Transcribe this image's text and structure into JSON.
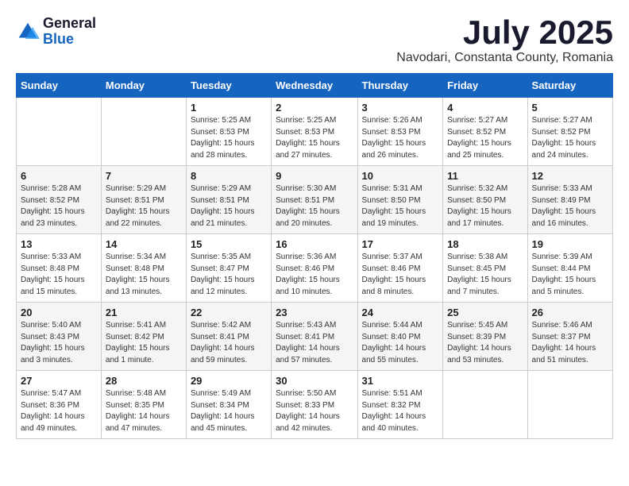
{
  "logo": {
    "general": "General",
    "blue": "Blue"
  },
  "title": {
    "month": "July 2025",
    "location": "Navodari, Constanta County, Romania"
  },
  "weekdays": [
    "Sunday",
    "Monday",
    "Tuesday",
    "Wednesday",
    "Thursday",
    "Friday",
    "Saturday"
  ],
  "weeks": [
    [
      {
        "day": "",
        "info": ""
      },
      {
        "day": "",
        "info": ""
      },
      {
        "day": "1",
        "info": "Sunrise: 5:25 AM\nSunset: 8:53 PM\nDaylight: 15 hours\nand 28 minutes."
      },
      {
        "day": "2",
        "info": "Sunrise: 5:25 AM\nSunset: 8:53 PM\nDaylight: 15 hours\nand 27 minutes."
      },
      {
        "day": "3",
        "info": "Sunrise: 5:26 AM\nSunset: 8:53 PM\nDaylight: 15 hours\nand 26 minutes."
      },
      {
        "day": "4",
        "info": "Sunrise: 5:27 AM\nSunset: 8:52 PM\nDaylight: 15 hours\nand 25 minutes."
      },
      {
        "day": "5",
        "info": "Sunrise: 5:27 AM\nSunset: 8:52 PM\nDaylight: 15 hours\nand 24 minutes."
      }
    ],
    [
      {
        "day": "6",
        "info": "Sunrise: 5:28 AM\nSunset: 8:52 PM\nDaylight: 15 hours\nand 23 minutes."
      },
      {
        "day": "7",
        "info": "Sunrise: 5:29 AM\nSunset: 8:51 PM\nDaylight: 15 hours\nand 22 minutes."
      },
      {
        "day": "8",
        "info": "Sunrise: 5:29 AM\nSunset: 8:51 PM\nDaylight: 15 hours\nand 21 minutes."
      },
      {
        "day": "9",
        "info": "Sunrise: 5:30 AM\nSunset: 8:51 PM\nDaylight: 15 hours\nand 20 minutes."
      },
      {
        "day": "10",
        "info": "Sunrise: 5:31 AM\nSunset: 8:50 PM\nDaylight: 15 hours\nand 19 minutes."
      },
      {
        "day": "11",
        "info": "Sunrise: 5:32 AM\nSunset: 8:50 PM\nDaylight: 15 hours\nand 17 minutes."
      },
      {
        "day": "12",
        "info": "Sunrise: 5:33 AM\nSunset: 8:49 PM\nDaylight: 15 hours\nand 16 minutes."
      }
    ],
    [
      {
        "day": "13",
        "info": "Sunrise: 5:33 AM\nSunset: 8:48 PM\nDaylight: 15 hours\nand 15 minutes."
      },
      {
        "day": "14",
        "info": "Sunrise: 5:34 AM\nSunset: 8:48 PM\nDaylight: 15 hours\nand 13 minutes."
      },
      {
        "day": "15",
        "info": "Sunrise: 5:35 AM\nSunset: 8:47 PM\nDaylight: 15 hours\nand 12 minutes."
      },
      {
        "day": "16",
        "info": "Sunrise: 5:36 AM\nSunset: 8:46 PM\nDaylight: 15 hours\nand 10 minutes."
      },
      {
        "day": "17",
        "info": "Sunrise: 5:37 AM\nSunset: 8:46 PM\nDaylight: 15 hours\nand 8 minutes."
      },
      {
        "day": "18",
        "info": "Sunrise: 5:38 AM\nSunset: 8:45 PM\nDaylight: 15 hours\nand 7 minutes."
      },
      {
        "day": "19",
        "info": "Sunrise: 5:39 AM\nSunset: 8:44 PM\nDaylight: 15 hours\nand 5 minutes."
      }
    ],
    [
      {
        "day": "20",
        "info": "Sunrise: 5:40 AM\nSunset: 8:43 PM\nDaylight: 15 hours\nand 3 minutes."
      },
      {
        "day": "21",
        "info": "Sunrise: 5:41 AM\nSunset: 8:42 PM\nDaylight: 15 hours\nand 1 minute."
      },
      {
        "day": "22",
        "info": "Sunrise: 5:42 AM\nSunset: 8:41 PM\nDaylight: 14 hours\nand 59 minutes."
      },
      {
        "day": "23",
        "info": "Sunrise: 5:43 AM\nSunset: 8:41 PM\nDaylight: 14 hours\nand 57 minutes."
      },
      {
        "day": "24",
        "info": "Sunrise: 5:44 AM\nSunset: 8:40 PM\nDaylight: 14 hours\nand 55 minutes."
      },
      {
        "day": "25",
        "info": "Sunrise: 5:45 AM\nSunset: 8:39 PM\nDaylight: 14 hours\nand 53 minutes."
      },
      {
        "day": "26",
        "info": "Sunrise: 5:46 AM\nSunset: 8:37 PM\nDaylight: 14 hours\nand 51 minutes."
      }
    ],
    [
      {
        "day": "27",
        "info": "Sunrise: 5:47 AM\nSunset: 8:36 PM\nDaylight: 14 hours\nand 49 minutes."
      },
      {
        "day": "28",
        "info": "Sunrise: 5:48 AM\nSunset: 8:35 PM\nDaylight: 14 hours\nand 47 minutes."
      },
      {
        "day": "29",
        "info": "Sunrise: 5:49 AM\nSunset: 8:34 PM\nDaylight: 14 hours\nand 45 minutes."
      },
      {
        "day": "30",
        "info": "Sunrise: 5:50 AM\nSunset: 8:33 PM\nDaylight: 14 hours\nand 42 minutes."
      },
      {
        "day": "31",
        "info": "Sunrise: 5:51 AM\nSunset: 8:32 PM\nDaylight: 14 hours\nand 40 minutes."
      },
      {
        "day": "",
        "info": ""
      },
      {
        "day": "",
        "info": ""
      }
    ]
  ]
}
